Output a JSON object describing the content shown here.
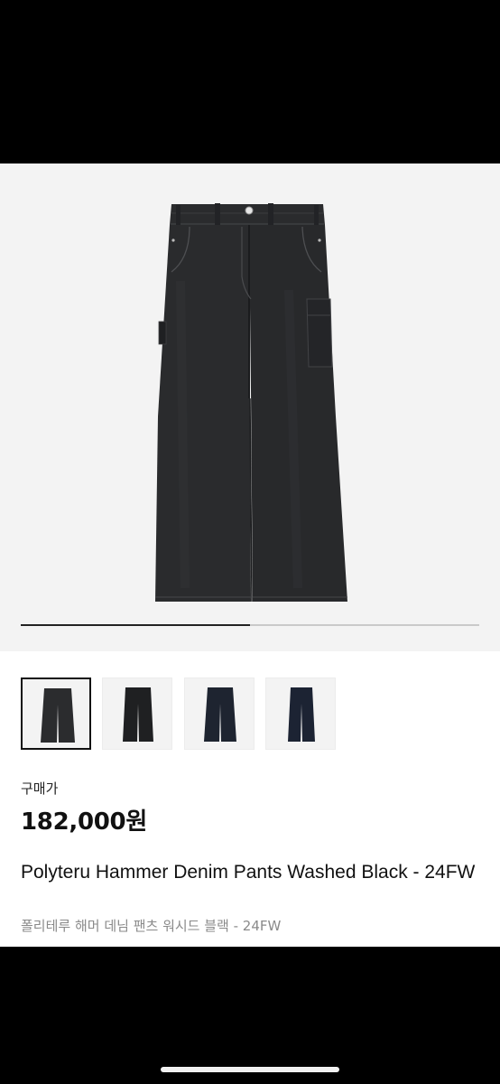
{
  "product": {
    "price_label": "구매가",
    "price": "182,000원",
    "title": "Polyteru Hammer Denim Pants Washed Black - 24FW",
    "subtitle": "폴리테루 해머 데님 팬츠 워시드 블랙 - 24FW"
  },
  "gallery": {
    "image_progress": 0.5,
    "main_image_icon": "black-wide-denim-pants-image",
    "thumbnails": [
      {
        "icon": "washed-black-pants-front-thumbnail",
        "color": "#2b2c2e",
        "selected": true
      },
      {
        "icon": "black-pants-thumbnail",
        "color": "#1f2022",
        "selected": false
      },
      {
        "icon": "dark-indigo-pants-thumbnail",
        "color": "#1e2430",
        "selected": false
      },
      {
        "icon": "indigo-pants-thumbnail",
        "color": "#1c2333",
        "selected": false
      }
    ]
  },
  "colors": {
    "pants": "#2a2b2d",
    "pants_shadow": "#1b1c1e",
    "pants_highlight": "#3c3d40",
    "stitch": "#5a5b5e"
  }
}
